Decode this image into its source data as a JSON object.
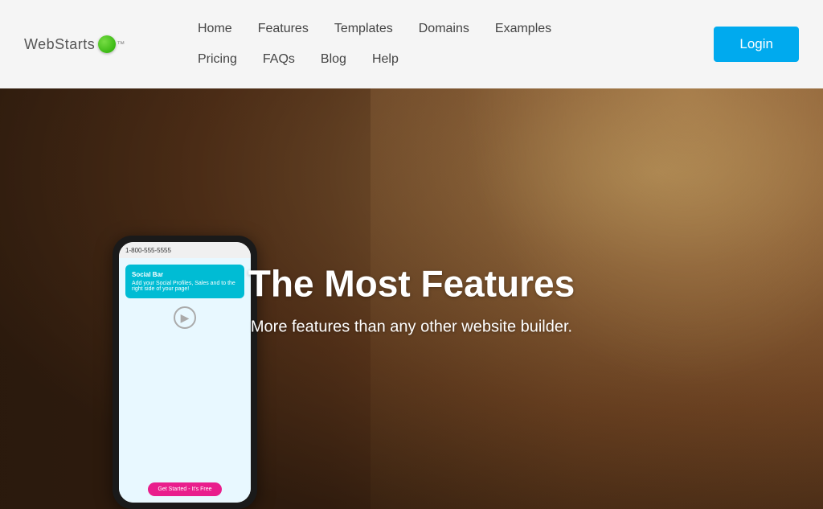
{
  "header": {
    "logo_text": "WebStarts",
    "logo_tm": "™",
    "login_label": "Login",
    "nav_row1": [
      {
        "label": "Home",
        "id": "home"
      },
      {
        "label": "Features",
        "id": "features"
      },
      {
        "label": "Templates",
        "id": "templates"
      },
      {
        "label": "Domains",
        "id": "domains"
      },
      {
        "label": "Examples",
        "id": "examples"
      }
    ],
    "nav_row2": [
      {
        "label": "Pricing",
        "id": "pricing"
      },
      {
        "label": "FAQs",
        "id": "faqs"
      },
      {
        "label": "Blog",
        "id": "blog"
      },
      {
        "label": "Help",
        "id": "help"
      }
    ]
  },
  "hero": {
    "title": "The Most Features",
    "subtitle": "More features than any other website builder.",
    "phone": {
      "status_text": "1-800-555-5555",
      "card_title": "Social Bar",
      "card_body": "Add your Social Profiles, Sales and to the right side of your page!",
      "circle_icon": "▶",
      "btn_label": "Get Started - It's Free"
    }
  },
  "colors": {
    "login_bg": "#00aaee",
    "nav_link": "#444444",
    "hero_title": "#ffffff",
    "hero_subtitle": "#ffffff"
  }
}
